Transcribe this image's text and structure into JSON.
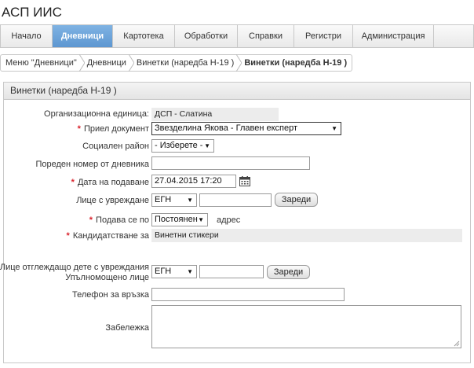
{
  "app": {
    "title": "АСП ИИС"
  },
  "nav": {
    "items": [
      {
        "label": "Начало",
        "active": false
      },
      {
        "label": "Дневници",
        "active": true
      },
      {
        "label": "Картотека",
        "active": false
      },
      {
        "label": "Обработки",
        "active": false
      },
      {
        "label": "Справки",
        "active": false
      },
      {
        "label": "Регистри",
        "active": false
      },
      {
        "label": "Администрация",
        "active": false
      }
    ]
  },
  "breadcrumb": {
    "items": [
      "Меню \"Дневници\"",
      "Дневници",
      "Винетки (наредба Н-19 )",
      "Винетки (наредба Н-19 )"
    ]
  },
  "panel": {
    "title": "Винетки (наредба Н-19 )"
  },
  "form": {
    "org_unit": {
      "label": "Организационна единица:",
      "value": "ДСП - Слатина"
    },
    "received_doc": {
      "label": "Приел документ",
      "value": "Звезделина Якова - Главен експерт",
      "required": true
    },
    "social_district": {
      "label": "Социален район",
      "value": "- Изберете -"
    },
    "journal_number": {
      "label": "Пореден номер от дневника",
      "value": ""
    },
    "submission_date": {
      "label": "Дата на подаване",
      "value": "27.04.2015 17:20",
      "required": true
    },
    "disabled_person": {
      "label": "Лице с увреждане",
      "id_type": "ЕГН",
      "id_value": "",
      "load_button": "Зареди"
    },
    "submitted_to": {
      "label": "Подава се по",
      "value": "Постоянен",
      "suffix": "адрес",
      "required": true
    },
    "applying_for": {
      "label": "Кандидатстване за",
      "value": "Винетни стикери",
      "required": true
    },
    "caregiver": {
      "label_line1": "Лице отглеждащо дете с увреждания",
      "label_line2": "Упълномощено лице",
      "id_type": "ЕГН",
      "id_value": "",
      "load_button": "Зареди"
    },
    "phone": {
      "label": "Телефон за връзка",
      "value": ""
    },
    "note": {
      "label": "Забележка",
      "value": ""
    }
  },
  "colors": {
    "accent": "#5d97d1",
    "required": "#d9232d"
  },
  "icons": {
    "calendar": "calendar-icon",
    "dropdown": "chevron-down-icon"
  }
}
